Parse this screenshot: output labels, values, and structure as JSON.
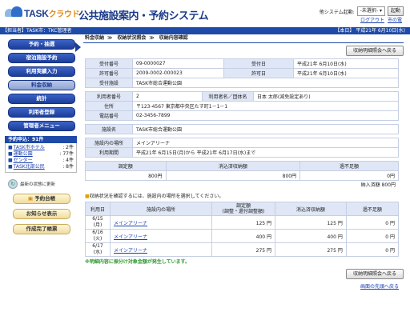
{
  "header": {
    "logo_main": "TASK",
    "logo_kana": "クラウド",
    "system_title": "公共施設案内・予約システム",
    "startup_label": "他システム起動:",
    "startup_select": "-未選択-",
    "startup_button": "起動",
    "logout": "ログアウト",
    "home": "市の電"
  },
  "userbar": {
    "user": "【担当者】TASK市：TKC管理者",
    "today": "【本日】 平成21年 6月10日(水)"
  },
  "sidebar": {
    "menu": [
      {
        "label": "予約・抽選",
        "active": false
      },
      {
        "label": "宿泊施設予約",
        "active": false
      },
      {
        "label": "利用実績入力",
        "active": false
      },
      {
        "label": "料金収納",
        "active": true
      },
      {
        "label": "統計",
        "active": false
      },
      {
        "label": "利用者登録",
        "active": false
      },
      {
        "label": "管理者メニュー",
        "active": false
      }
    ],
    "schedule_title": "予約申込：91件",
    "schedule": [
      {
        "name": "TASK市ホテル",
        "count": ": 2件"
      },
      {
        "name": "運動公園",
        "count": ": 77件"
      },
      {
        "name": "センター",
        "count": ": 4件"
      },
      {
        "name": "TASK北部公民",
        "count": ": 8件"
      }
    ],
    "refresh_label": "最新の状態に更新",
    "buttons": [
      "予約台帳",
      "お知らせ表示",
      "作成完了帳票"
    ]
  },
  "breadcrumb": [
    "料金収納",
    "収納状況照会",
    "収納内容確認"
  ],
  "actions": {
    "back_to_list": "収納明細照会へ戻る"
  },
  "reception": {
    "rows": [
      {
        "l1": "受付番号",
        "v1": "09-0000027",
        "l2": "受付日",
        "v2": "平成21年 6月10日(水)"
      },
      {
        "l1": "許可番号",
        "v1": "2009-0002-000023",
        "l2": "許可日",
        "v2": "平成21年 6月10日(水)"
      },
      {
        "l1": "受付施設",
        "v1": "TASK市総合運動公園",
        "l2": "",
        "v2": ""
      }
    ]
  },
  "user": {
    "no_label": "利用者番号",
    "no": "2",
    "name_label": "利用者名／団体名",
    "name": "日本 太郎(減免設定あり)",
    "addr_label": "住所",
    "addr": "〒123-4567 東京都中央区たす町1－1－1",
    "tel_label": "電話番号",
    "tel": "02-3456-7899"
  },
  "facility": {
    "label": "施設名",
    "value": "TASK市総合運動公園"
  },
  "usage": {
    "place_label": "施設内の場所",
    "place": "メインアリーナ",
    "period_label": "利用期間",
    "period": "平成21年 6月15日(月)から 平成21年 6月17日(水)まで"
  },
  "money": {
    "headers": [
      "調定額",
      "消込済収納額",
      "過不足額"
    ],
    "values": [
      "800円",
      "800円",
      "0円"
    ],
    "total": "納入済額 800円"
  },
  "notice": "収納状況を確認するには、施設内の場所を選択してください。",
  "list": {
    "headers": [
      "利用日",
      "施設内の場所",
      "調定額\n(調整・還付調整額)",
      "消込済収納額",
      "過不足額"
    ],
    "rows": [
      {
        "date": "6/15",
        "dow": "(月)",
        "place": "メインアリーナ",
        "amount": "125 円",
        "paid": "125 円",
        "diff": "0 円"
      },
      {
        "date": "6/16",
        "dow": "(火)",
        "place": "メインアリーナ",
        "amount": "400 円",
        "paid": "400 円",
        "diff": "0 円"
      },
      {
        "date": "6/17",
        "dow": "(水)",
        "place": "メインアリーナ",
        "amount": "275 円",
        "paid": "275 円",
        "diff": "0 円"
      }
    ]
  },
  "green_note": "※明細内容に振分け対象金額が発生しています。",
  "back_top": "画面の先頭へ戻る"
}
